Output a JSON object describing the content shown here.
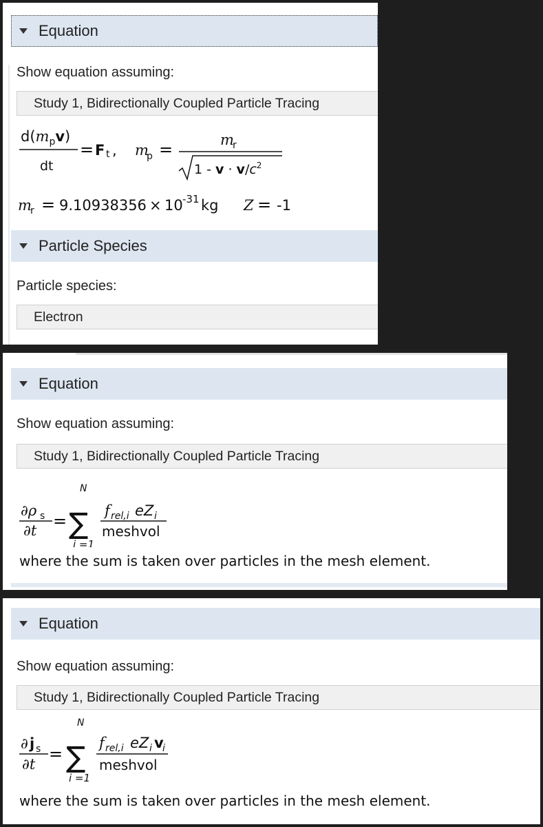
{
  "panel1": {
    "equation_header": "Equation",
    "show_label": "Show equation assuming:",
    "study_value": "Study 1, Bidirectionally Coupled Particle Tracing",
    "eq": {
      "d_left": "d(",
      "m": "m",
      "sub_p": "p",
      "bold_v": "v",
      "rparen": ")",
      "dt": "dt",
      "eq_sign": "=",
      "F": "F",
      "sub_t": "t",
      "comma": ",",
      "m2": "m",
      "sub_p2": "p",
      "eq2": "=",
      "num_m": "m",
      "num_sub_r": "r",
      "den": "1 - ",
      "den_v1": "v",
      "den_dot": " · ",
      "den_v2": "v",
      "den_slash": "/",
      "den_c": "c",
      "den_sq": "2"
    },
    "constants": {
      "m": "m",
      "sub_r": "r",
      "eq": "=",
      "value": "9.10938356",
      "times": "×",
      "ten": "10",
      "exp": "-31",
      "unit": "kg",
      "Z": "Z",
      "Zeq": "=",
      "Zval": "-1"
    },
    "species_header": "Particle Species",
    "species_label": "Particle species:",
    "species_value": "Electron"
  },
  "panel2": {
    "equation_header": "Equation",
    "show_label": "Show equation assuming:",
    "study_value": "Study 1, Bidirectionally Coupled Particle Tracing",
    "eq": {
      "partial": "∂",
      "rho": "ρ",
      "sub_s": "s",
      "dt": "∂t",
      "eq": "=",
      "N": "N",
      "sigma": "∑",
      "lower": "i =1",
      "num_f": "f",
      "num_sub": "rel,i",
      "num_rest": "eZ",
      "num_sub_i": "i",
      "den": "meshvol"
    },
    "where": "where the sum is taken over particles in the mesh element."
  },
  "panel3": {
    "equation_header": "Equation",
    "show_label": "Show equation assuming:",
    "study_value": "Study 1, Bidirectionally Coupled Particle Tracing",
    "eq": {
      "partial": "∂",
      "j": "j",
      "sub_s": "s",
      "dt": "∂t",
      "eq": "=",
      "N": "N",
      "sigma": "∑",
      "lower": "i =1",
      "num_f": "f",
      "num_sub": "rel,i",
      "num_rest": "eZ",
      "num_sub_i": "i",
      "num_v": "v",
      "num_sub_i2": "i",
      "den": "meshvol"
    },
    "where": "where the sum is taken over particles in the mesh element."
  }
}
